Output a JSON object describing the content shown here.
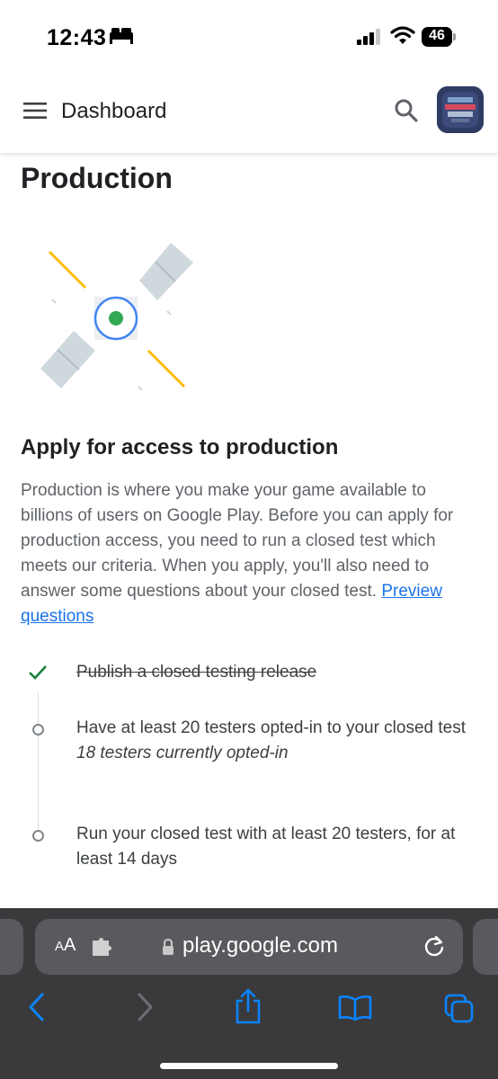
{
  "status_bar": {
    "time": "12:43",
    "battery": "46",
    "icons": [
      "bed-icon",
      "cellular-signal-icon",
      "wifi-icon",
      "battery-icon"
    ]
  },
  "header": {
    "title": "Dashboard",
    "icons": [
      "menu-icon",
      "search-icon",
      "app-icon"
    ]
  },
  "main": {
    "page_title": "Production",
    "illustration": "satellite-illustration",
    "section_heading": "Apply for access to production",
    "description": "Production is where you make your game available to billions of users on Google Play. Before you can apply for production access, you need to run a closed test which meets our criteria. When you apply, you'll also need to answer some questions about your closed test.",
    "preview_link": "Preview questions",
    "steps": [
      {
        "text": "Publish a closed testing release",
        "status": "completed",
        "note": ""
      },
      {
        "text": "Have at least 20 testers opted-in to your closed test",
        "status": "pending",
        "note": "18 testers currently opted-in"
      },
      {
        "text": "Run your closed test with at least 20 testers, for at least 14 days",
        "status": "pending",
        "note": ""
      }
    ]
  },
  "browser": {
    "text_size_label_small": "A",
    "text_size_label_large": "A",
    "url": "play.google.com",
    "toolbar": [
      "back-icon",
      "forward-icon",
      "share-icon",
      "bookmarks-icon",
      "tabs-icon"
    ]
  },
  "colors": {
    "link": "#1a73e8",
    "check": "#188038",
    "browser_accent": "#0a84ff",
    "satellite_center": "#34a853",
    "satellite_ring": "#4285f4",
    "satellite_rays": "#fbbc04"
  }
}
